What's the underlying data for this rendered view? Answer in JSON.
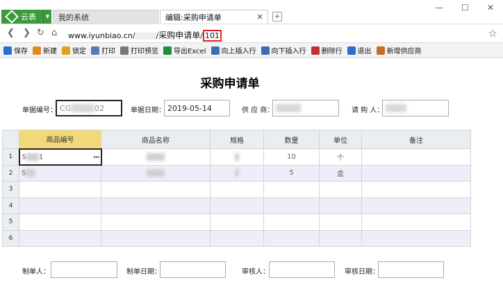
{
  "browser": {
    "app_label": "云表",
    "tabs": [
      {
        "label": "我的系统"
      },
      {
        "label": "编辑:采购申请单"
      }
    ],
    "tab_close": "×",
    "new_tab": "+",
    "window_controls": {
      "minimize": "—",
      "maximize": "☐",
      "close": "✕"
    },
    "url": {
      "host": "www.iyunbiao.cn/",
      "path_sep": "/",
      "page": "采购申请单",
      "id_sep": "/",
      "highlight": "101"
    }
  },
  "toolbar": {
    "buttons": [
      {
        "label": "保存",
        "icon": "save-icon",
        "color": "#2a6fc9"
      },
      {
        "label": "新建",
        "icon": "new-icon",
        "color": "#e08a1e"
      },
      {
        "label": "锁定",
        "icon": "lock-icon",
        "color": "#e0a21e"
      },
      {
        "label": "打印",
        "icon": "print-icon",
        "color": "#5a7ab0"
      },
      {
        "label": "打印预览",
        "icon": "print-preview-icon",
        "color": "#777777"
      },
      {
        "label": "导出Excel",
        "icon": "excel-icon",
        "color": "#1f8f3a"
      },
      {
        "label": "向上插入行",
        "icon": "insert-above-icon",
        "color": "#3a6fb0"
      },
      {
        "label": "向下插入行",
        "icon": "insert-below-icon",
        "color": "#3a6fb0"
      },
      {
        "label": "删除行",
        "icon": "delete-row-icon",
        "color": "#c03030"
      },
      {
        "label": "退出",
        "icon": "exit-icon",
        "color": "#2a6fc9"
      },
      {
        "label": "新增供应商",
        "icon": "add-supplier-icon",
        "color": "#c07020"
      }
    ]
  },
  "form": {
    "title": "采购申请单",
    "doc_no_label": "单据编号：",
    "doc_no_prefix": "CG",
    "doc_no_suffix": "02",
    "doc_date_label": "单据日期：",
    "doc_date_value": "2019-05-14",
    "supplier_label": "供 应 商：",
    "requester_label": "请 购 人："
  },
  "grid": {
    "columns": [
      "商品编号",
      "商品名称",
      "规格",
      "数量",
      "单位",
      "备注"
    ],
    "rows": [
      {
        "no": "1",
        "code": "S",
        "code_tail": "1",
        "qty": "10",
        "unit": "个"
      },
      {
        "no": "2",
        "code": "S",
        "code_tail": "",
        "qty": "5",
        "unit": "盒"
      },
      {
        "no": "3",
        "code": "",
        "code_tail": "",
        "qty": "",
        "unit": ""
      },
      {
        "no": "4",
        "code": "",
        "code_tail": "",
        "qty": "",
        "unit": ""
      },
      {
        "no": "5",
        "code": "",
        "code_tail": "",
        "qty": "",
        "unit": ""
      },
      {
        "no": "6",
        "code": "",
        "code_tail": "",
        "qty": "",
        "unit": ""
      }
    ],
    "more_button": "···"
  },
  "footer": {
    "maker_label": "制单人：",
    "make_date_label": "制单日期：",
    "reviewer_label": "审核人：",
    "review_date_label": "审核日期："
  }
}
